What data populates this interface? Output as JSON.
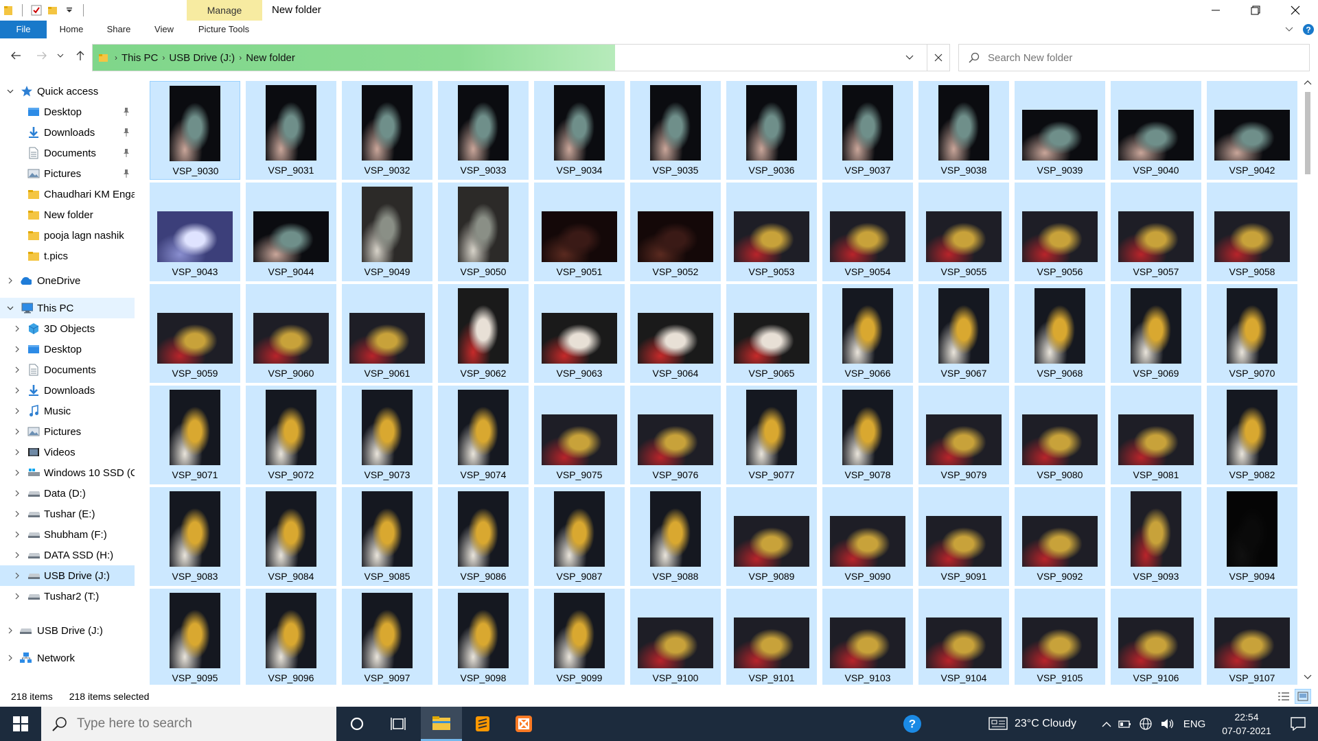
{
  "window": {
    "title": "New folder",
    "context_tab": "Manage",
    "minimize": "—",
    "maximize": "❐",
    "close": "✕"
  },
  "ribbon": {
    "tabs": [
      "File",
      "Home",
      "Share",
      "View",
      "Picture Tools"
    ]
  },
  "address": {
    "crumbs": [
      "This PC",
      "USB Drive (J:)",
      "New folder"
    ],
    "progress_percent": 61
  },
  "search": {
    "placeholder": "Search New folder"
  },
  "nav": {
    "quick_access": {
      "label": "Quick access",
      "items": [
        {
          "label": "Desktop",
          "pinned": true
        },
        {
          "label": "Downloads",
          "pinned": true
        },
        {
          "label": "Documents",
          "pinned": true
        },
        {
          "label": "Pictures",
          "pinned": true
        },
        {
          "label": "Chaudhari KM Enga",
          "pinned": false
        },
        {
          "label": "New folder",
          "pinned": false
        },
        {
          "label": "pooja lagn nashik",
          "pinned": false
        },
        {
          "label": "t.pics",
          "pinned": false
        }
      ]
    },
    "onedrive": "OneDrive",
    "this_pc": {
      "label": "This PC",
      "items": [
        "3D Objects",
        "Desktop",
        "Documents",
        "Downloads",
        "Music",
        "Pictures",
        "Videos",
        "Windows 10 SSD (C",
        "Data (D:)",
        "Tushar (E:)",
        "Shubham (F:)",
        "DATA SSD (H:)",
        "USB Drive (J:)",
        "Tushar2 (T:)"
      ]
    },
    "usb_drive": "USB Drive (J:)",
    "network": "Network"
  },
  "files": [
    "VSP_9030",
    "VSP_9031",
    "VSP_9032",
    "VSP_9033",
    "VSP_9034",
    "VSP_9035",
    "VSP_9036",
    "VSP_9037",
    "VSP_9038",
    "VSP_9039",
    "VSP_9040",
    "VSP_9042",
    "VSP_9043",
    "VSP_9044",
    "VSP_9049",
    "VSP_9050",
    "VSP_9051",
    "VSP_9052",
    "VSP_9053",
    "VSP_9054",
    "VSP_9055",
    "VSP_9056",
    "VSP_9057",
    "VSP_9058",
    "VSP_9059",
    "VSP_9060",
    "VSP_9061",
    "VSP_9062",
    "VSP_9063",
    "VSP_9064",
    "VSP_9065",
    "VSP_9066",
    "VSP_9067",
    "VSP_9068",
    "VSP_9069",
    "VSP_9070",
    "VSP_9071",
    "VSP_9072",
    "VSP_9073",
    "VSP_9074",
    "VSP_9075",
    "VSP_9076",
    "VSP_9077",
    "VSP_9078",
    "VSP_9079",
    "VSP_9080",
    "VSP_9081",
    "VSP_9082",
    "VSP_9083",
    "VSP_9084",
    "VSP_9085",
    "VSP_9086",
    "VSP_9087",
    "VSP_9088",
    "VSP_9089",
    "VSP_9090",
    "VSP_9091",
    "VSP_9092",
    "VSP_9093",
    "VSP_9094",
    "VSP_9095",
    "VSP_9096",
    "VSP_9097",
    "VSP_9098",
    "VSP_9099",
    "VSP_9100",
    "VSP_9101",
    "VSP_9103",
    "VSP_9104",
    "VSP_9105",
    "VSP_9106",
    "VSP_9107"
  ],
  "file_orientation": [
    "p",
    "p",
    "p",
    "p",
    "p",
    "p",
    "p",
    "p",
    "p",
    "l",
    "l",
    "l",
    "l",
    "l",
    "p",
    "p",
    "l",
    "l",
    "l",
    "l",
    "l",
    "l",
    "l",
    "l",
    "l",
    "l",
    "l",
    "p",
    "l",
    "l",
    "l",
    "p",
    "p",
    "p",
    "p",
    "p",
    "p",
    "p",
    "p",
    "p",
    "l",
    "l",
    "p",
    "p",
    "l",
    "l",
    "l",
    "p",
    "p",
    "p",
    "p",
    "p",
    "p",
    "p",
    "l",
    "l",
    "l",
    "l",
    "p",
    "p",
    "p",
    "p",
    "p",
    "p",
    "p",
    "l",
    "l",
    "l",
    "l",
    "l",
    "l",
    "l"
  ],
  "file_tone": [
    "night",
    "night",
    "night",
    "night",
    "night",
    "night",
    "night",
    "night",
    "night",
    "night",
    "night",
    "night",
    "flash",
    "night",
    "dusk",
    "dusk",
    "dark",
    "dark",
    "party",
    "party",
    "party",
    "party",
    "party",
    "party",
    "party",
    "party",
    "party",
    "cake",
    "cake",
    "cake",
    "cake",
    "gold",
    "gold",
    "gold",
    "gold",
    "gold",
    "gold",
    "gold",
    "gold",
    "gold",
    "party",
    "party",
    "gold",
    "gold",
    "party",
    "party",
    "party",
    "gold",
    "gold",
    "gold",
    "gold",
    "gold",
    "gold",
    "gold",
    "party",
    "party",
    "party",
    "party",
    "party",
    "black",
    "gold",
    "gold",
    "gold",
    "gold",
    "gold",
    "party",
    "party",
    "party",
    "party",
    "party",
    "party",
    "party"
  ],
  "status": {
    "count": "218 items",
    "selected": "218 items selected"
  },
  "taskbar": {
    "search_placeholder": "Type here to search",
    "weather": "23°C  Cloudy",
    "language": "ENG",
    "time": "22:54",
    "date": "07-07-2021"
  },
  "colors": {
    "selection": "#cce8ff",
    "accent": "#1979ca",
    "taskbar": "#1c2b3d",
    "address_progress": "#7fd68a"
  }
}
